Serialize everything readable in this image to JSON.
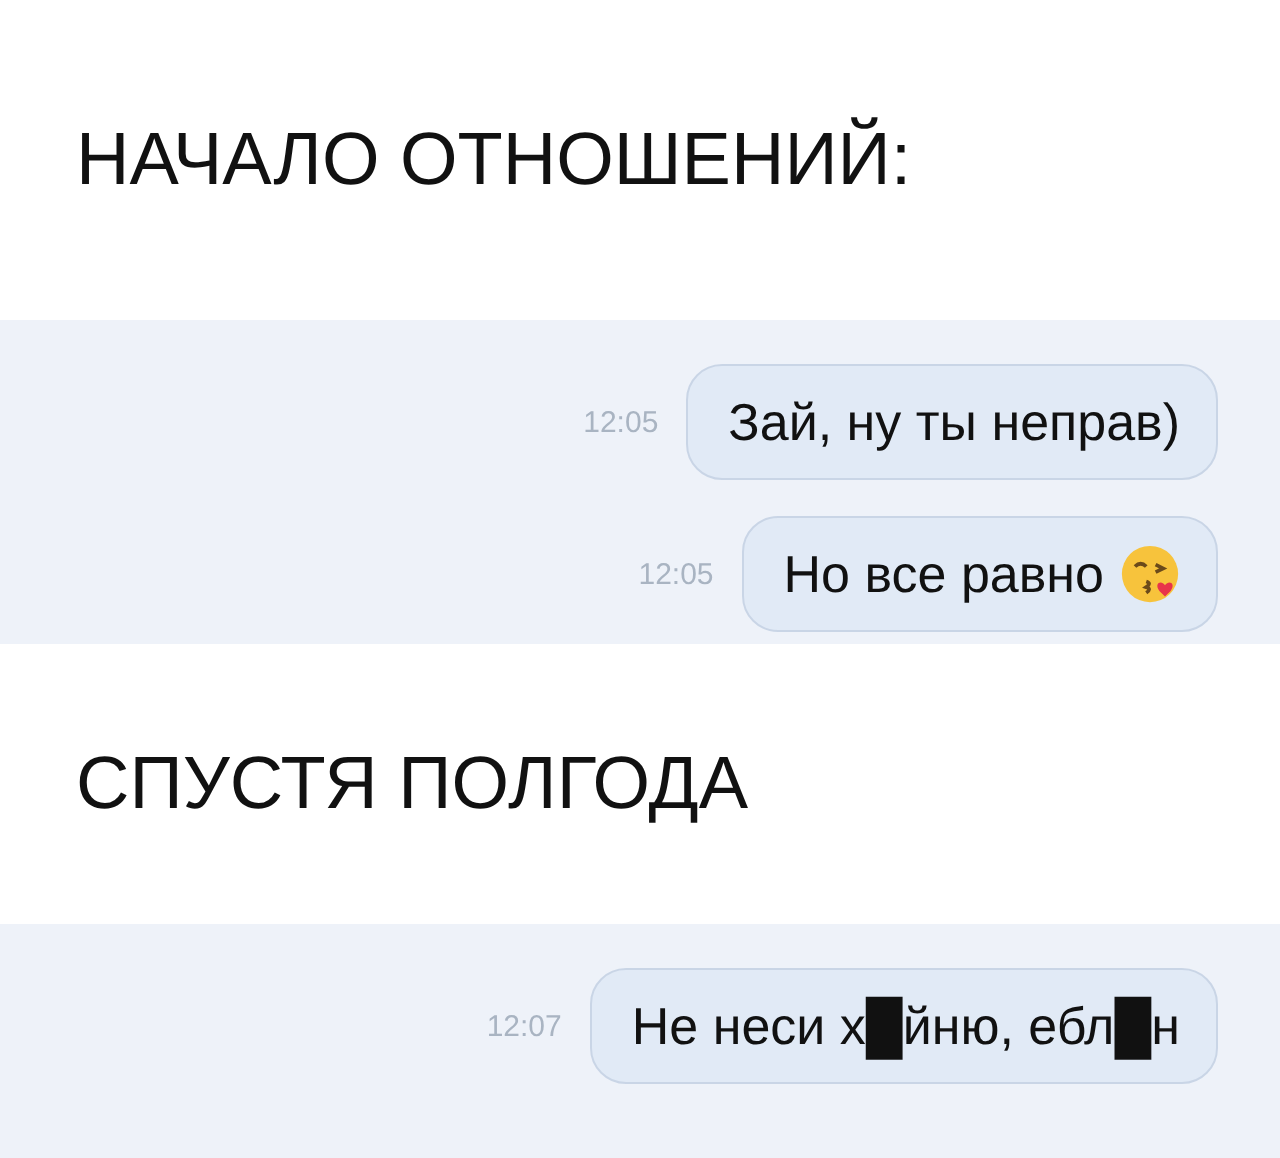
{
  "sections": [
    {
      "caption": "НАЧАЛО ОТНОШЕНИЙ:",
      "messages": [
        {
          "time": "12:05",
          "text": "Зай, ну ты неправ)",
          "has_emoji": false
        },
        {
          "time": "12:05",
          "text": "Но все равно",
          "has_emoji": true
        }
      ]
    },
    {
      "caption": "СПУСТЯ ПОЛГОДА",
      "messages": [
        {
          "time": "12:07",
          "text": "Не неси х█йню, ебл█н",
          "has_emoji": false
        }
      ]
    }
  ]
}
